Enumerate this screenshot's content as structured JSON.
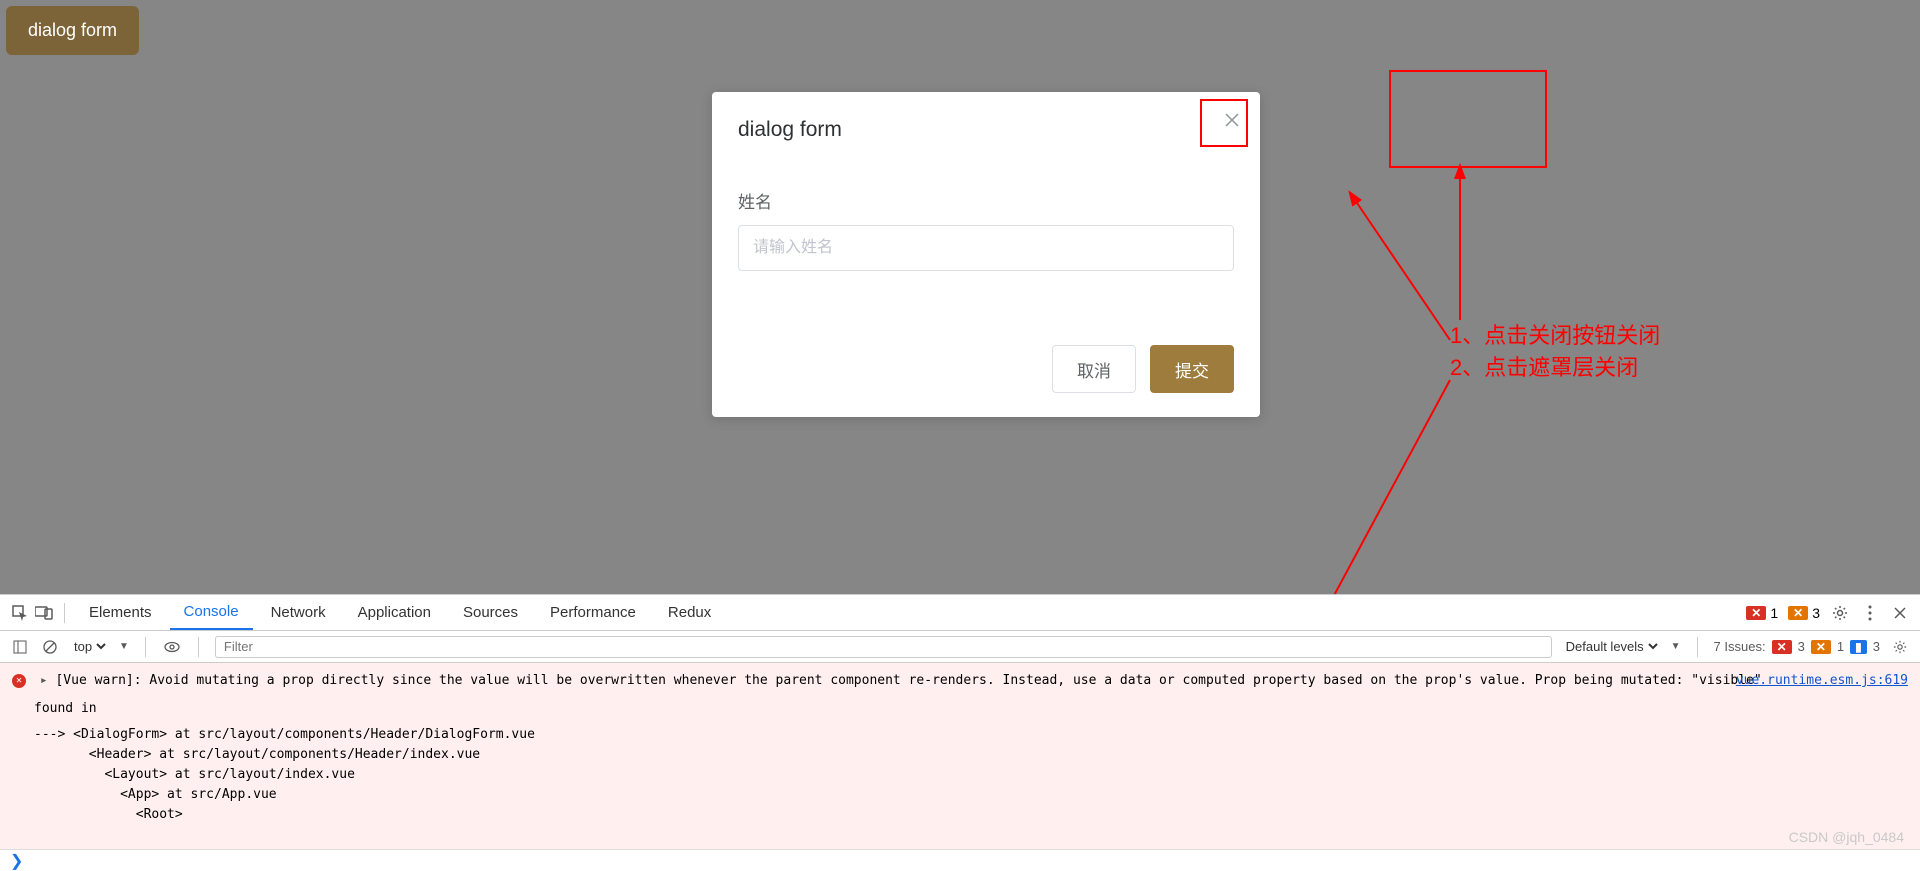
{
  "topbar": {
    "button_label": "dialog form"
  },
  "dialog": {
    "title": "dialog form",
    "name_label": "姓名",
    "name_placeholder": "请输入姓名",
    "cancel_label": "取消",
    "submit_label": "提交"
  },
  "annotations": {
    "line1": "1、点击关闭按钮关闭",
    "line2": "2、点击遮罩层关闭"
  },
  "devtools": {
    "tabs": [
      "Elements",
      "Console",
      "Network",
      "Application",
      "Sources",
      "Performance",
      "Redux"
    ],
    "active_tab": "Console",
    "top_error_count": "1",
    "top_warn_count": "3",
    "context": "top",
    "filter_placeholder": "Filter",
    "levels": "Default levels",
    "issues_label": "7 Issues:",
    "issues_err": "3",
    "issues_warn": "1",
    "issues_info": "3",
    "source_link": "vue.runtime.esm.js:619",
    "warn_line": "[Vue warn]: Avoid mutating a prop directly since the value will be overwritten whenever the parent component re-renders. Instead, use a data or computed property based on the prop's value. Prop being mutated: \"visible\"",
    "found_in": "found in",
    "trace": "---> <DialogForm> at src/layout/components/Header/DialogForm.vue\n       <Header> at src/layout/components/Header/index.vue\n         <Layout> at src/layout/index.vue\n           <App> at src/App.vue\n             <Root>"
  },
  "watermark": "CSDN @jqh_0484"
}
